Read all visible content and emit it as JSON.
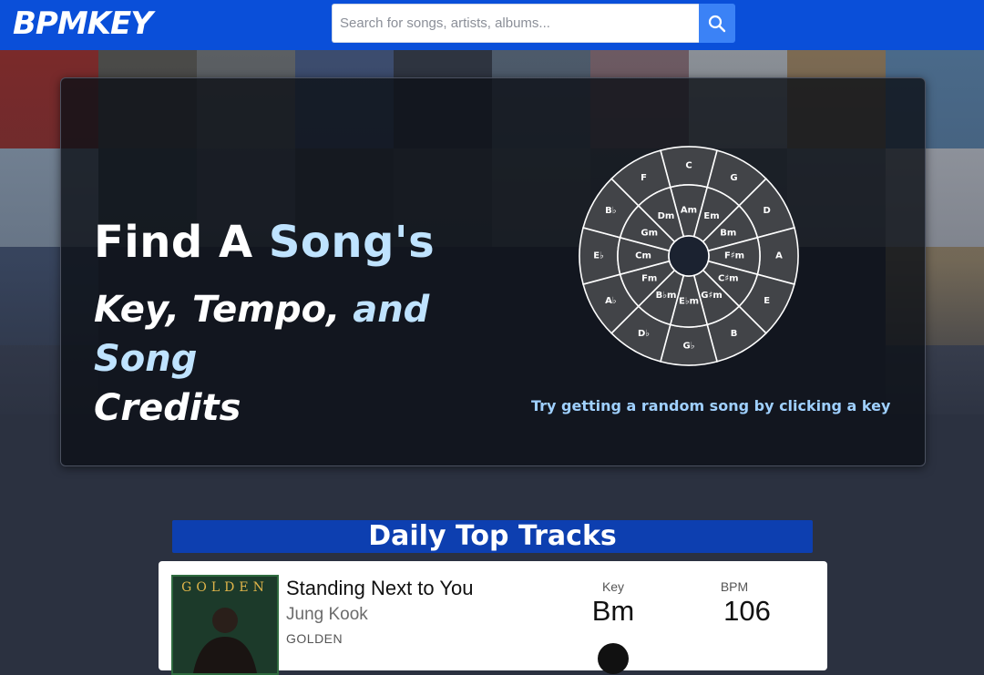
{
  "header": {
    "logo": "BPMKEY",
    "search_placeholder": "Search for songs, artists, albums...",
    "search_value": "",
    "search_button_icon": "search-icon",
    "bar_color": "#0a4fd9"
  },
  "hero": {
    "title_part1": "Find A ",
    "title_part2": "Song's",
    "subtitle_part1": "Key, Tempo, ",
    "subtitle_part2": "and Song",
    "subtitle_part3": "Credits",
    "random_hint": "Try getting a random song by clicking a key",
    "accent_color": "#bfe3ff",
    "wheel": {
      "major_keys": [
        "C",
        "G",
        "D",
        "A",
        "E",
        "B",
        "G♭",
        "D♭",
        "A♭",
        "E♭",
        "B♭",
        "F"
      ],
      "minor_keys": [
        "Am",
        "Em",
        "Bm",
        "F♯m",
        "C♯m",
        "G♯m",
        "E♭m",
        "B♭m",
        "Fm",
        "Cm",
        "Gm",
        "Dm"
      ]
    }
  },
  "daily": {
    "title": "Daily Top Tracks",
    "tracks": [
      {
        "title": "Standing Next to You",
        "artist": "Jung Kook",
        "album": "GOLDEN",
        "art_text": "GOLDEN",
        "key_label": "Key",
        "key": "Bm",
        "bpm_label": "BPM",
        "bpm": "106"
      }
    ]
  }
}
